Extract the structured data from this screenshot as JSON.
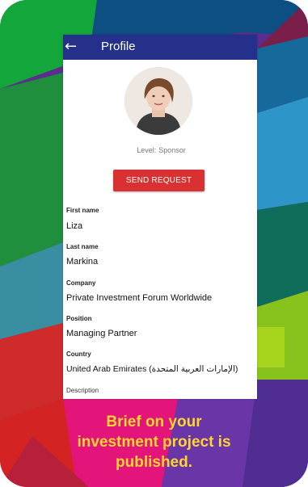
{
  "app": {
    "title": "Profile",
    "back_icon": "arrow-left-icon"
  },
  "profile": {
    "avatar_icon": "user-avatar-photo",
    "level_label": "Level:",
    "level_value": "Sponsor",
    "send_request_label": "SEND REQUEST",
    "fields": [
      {
        "label": "First name",
        "value": "Liza"
      },
      {
        "label": "Last name",
        "value": "Markina"
      },
      {
        "label": "Company",
        "value": "Private Investment Forum Worldwide"
      },
      {
        "label": "Position",
        "value": "Managing Partner"
      },
      {
        "label": "Country",
        "value": "United Arab Emirates (الإمارات العربية المتحدة)"
      }
    ],
    "description_label": "Description"
  },
  "caption": {
    "line1": "Brief on your",
    "line2": "investment project is",
    "line3": "published."
  },
  "colors": {
    "appbar": "#24308a",
    "button": "#d93131",
    "caption": "#ffd531"
  }
}
